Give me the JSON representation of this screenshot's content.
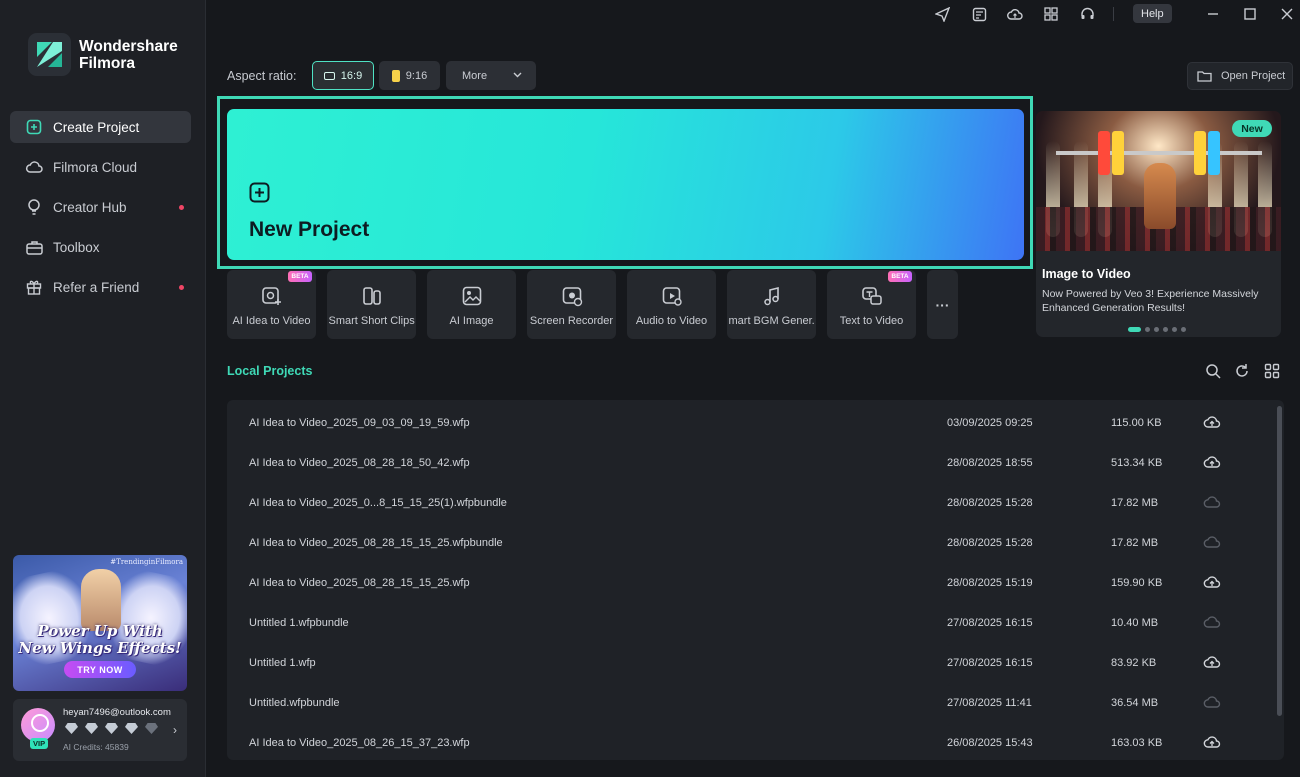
{
  "app": {
    "name_line1": "Wondershare",
    "name_line2": "Filmora"
  },
  "sidebar": {
    "items": [
      {
        "label": "Create Project",
        "icon": "plus-square-icon",
        "active": true,
        "dot": false
      },
      {
        "label": "Filmora Cloud",
        "icon": "cloud-icon",
        "active": false,
        "dot": false
      },
      {
        "label": "Creator Hub",
        "icon": "bulb-icon",
        "active": false,
        "dot": true
      },
      {
        "label": "Toolbox",
        "icon": "toolbox-icon",
        "active": false,
        "dot": false
      },
      {
        "label": "Refer a Friend",
        "icon": "gift-icon",
        "active": false,
        "dot": true
      }
    ],
    "promo": {
      "tag": "#TrendinginFilmora",
      "line1": "Power Up With",
      "line2": "New Wings Effects!",
      "cta": "TRY NOW"
    },
    "account": {
      "email": "heyan7496@outlook.com",
      "badge": "VIP",
      "credits": "AI Credits: 45839"
    }
  },
  "titlebar": {
    "help": "Help"
  },
  "aspect": {
    "label": "Aspect ratio:",
    "options": [
      {
        "label": "16:9"
      },
      {
        "label": "9:16"
      }
    ],
    "more": "More",
    "open_project": "Open Project"
  },
  "new_project": {
    "label": "New Project"
  },
  "banner": {
    "badge": "New",
    "title": "Image to Video",
    "desc": "Now Powered by Veo 3! Experience Massively Enhanced Generation Results!"
  },
  "tools": [
    {
      "label": "AI Idea to Video",
      "icon": "ai-idea-video-icon",
      "beta": "BETA"
    },
    {
      "label": "Smart Short Clips",
      "icon": "short-clips-icon",
      "beta": ""
    },
    {
      "label": "AI Image",
      "icon": "ai-image-icon",
      "beta": ""
    },
    {
      "label": "Screen Recorder",
      "icon": "screen-recorder-icon",
      "beta": ""
    },
    {
      "label": "Audio to Video",
      "icon": "audio-video-icon",
      "beta": ""
    },
    {
      "label": "mart BGM Gener.",
      "icon": "bgm-icon",
      "beta": ""
    },
    {
      "label": "Text to Video",
      "icon": "text-video-icon",
      "beta": "BETA"
    }
  ],
  "local_projects": {
    "title": "Local Projects",
    "rows": [
      {
        "name": "AI Idea to Video_2025_09_03_09_19_59.wfp",
        "date": "03/09/2025 09:25",
        "size": "115.00 KB",
        "cloud": "upload"
      },
      {
        "name": "AI Idea to Video_2025_08_28_18_50_42.wfp",
        "date": "28/08/2025 18:55",
        "size": "513.34 KB",
        "cloud": "upload"
      },
      {
        "name": "AI Idea to Video_2025_0...8_15_15_25(1).wfpbundle",
        "date": "28/08/2025 15:28",
        "size": "17.82 MB",
        "cloud": "disabled"
      },
      {
        "name": "AI Idea to Video_2025_08_28_15_15_25.wfpbundle",
        "date": "28/08/2025 15:28",
        "size": "17.82 MB",
        "cloud": "disabled"
      },
      {
        "name": "AI Idea to Video_2025_08_28_15_15_25.wfp",
        "date": "28/08/2025 15:19",
        "size": "159.90 KB",
        "cloud": "upload"
      },
      {
        "name": "Untitled 1.wfpbundle",
        "date": "27/08/2025 16:15",
        "size": "10.40 MB",
        "cloud": "disabled"
      },
      {
        "name": "Untitled 1.wfp",
        "date": "27/08/2025 16:15",
        "size": "83.92 KB",
        "cloud": "upload"
      },
      {
        "name": "Untitled.wfpbundle",
        "date": "27/08/2025 11:41",
        "size": "36.54 MB",
        "cloud": "disabled"
      },
      {
        "name": "AI Idea to Video_2025_08_26_15_37_23.wfp",
        "date": "26/08/2025 15:43",
        "size": "163.03 KB",
        "cloud": "upload"
      }
    ]
  },
  "colors": {
    "accent": "#3fd9b6",
    "sidebar_bg": "#1e2025",
    "main_bg": "#16181c",
    "notification_dot": "#ef4565"
  }
}
